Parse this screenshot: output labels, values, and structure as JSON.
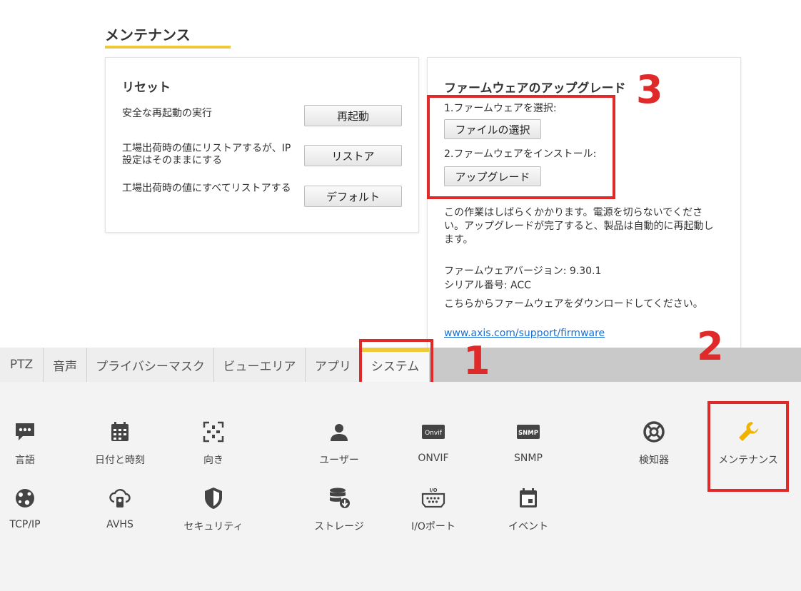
{
  "page_title": "メンテナンス",
  "reset": {
    "title": "リセット",
    "rows": [
      {
        "text": "安全な再起動の実行",
        "button": "再起動"
      },
      {
        "text": "工場出荷時の値にリストアするが、IP設定はそのままにする",
        "button": "リストア"
      },
      {
        "text": "工場出荷時の値にすべてリストアする",
        "button": "デフォルト"
      }
    ]
  },
  "firmware": {
    "title": "ファームウェアのアップグレード",
    "step1_label": "1.ファームウェアを選択:",
    "step1_button": "ファイルの選択",
    "step2_label": "2.ファームウェアをインストール:",
    "step2_button": "アップグレード",
    "note": "この作業はしばらくかかります。電源を切らないでください。アップグレードが完了すると、製品は自動的に再起動します。",
    "version": "ファームウェアバージョン: 9.30.1",
    "serial": "シリアル番号: ACC",
    "download_text": "こちらからファームウェアをダウンロードしてください。",
    "link": "www.axis.com/support/firmware"
  },
  "annotations": {
    "n1": "1",
    "n2": "2",
    "n3": "3"
  },
  "tabs": [
    "PTZ",
    "音声",
    "プライバシーマスク",
    "ビューエリア",
    "アプリ",
    "システム"
  ],
  "system_items_row1": [
    "言語",
    "日付と時刻",
    "向き",
    "ユーザー",
    "ONVIF",
    "SNMP",
    "検知器",
    "メンテナンス"
  ],
  "system_items_row2": [
    "TCP/IP",
    "AVHS",
    "セキュリティ",
    "ストレージ",
    "I/Oポート",
    "イベント"
  ],
  "icon_text": {
    "onvif": "Onvif",
    "snmp": "SNMP",
    "io": "I/O"
  },
  "colors": {
    "accent": "#f0c93a",
    "annotation": "#e02a2a",
    "link": "#1a6fd1",
    "icon": "#444444",
    "wrench": "#f0b400"
  }
}
